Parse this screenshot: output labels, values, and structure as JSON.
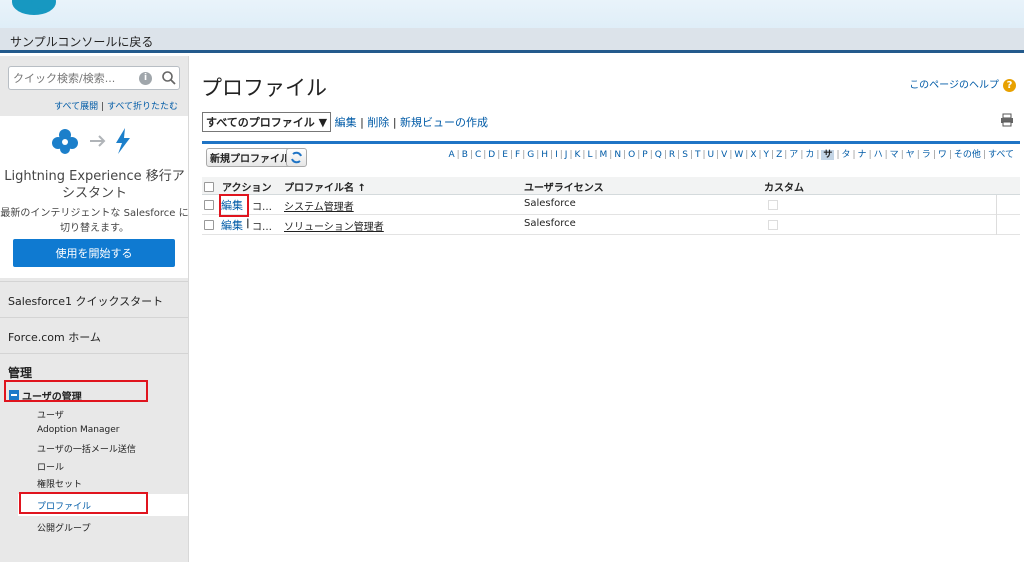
{
  "header": {
    "back_label": "サンプルコンソールに戻る"
  },
  "sidebar": {
    "search_placeholder": "クイック検索/検索...",
    "expand_all": "すべて展開",
    "collapse_all": "すべて折りたたむ",
    "expand_sep": "|",
    "lex": {
      "title": "Lightning Experience 移行アシスタント",
      "description": "最新のインテリジェントな Salesforce に切り替えます。",
      "button": "使用を開始する"
    },
    "sections": [
      {
        "label": "Salesforce1 クイックスタート"
      },
      {
        "label": "Force.com ホーム"
      }
    ],
    "admin_title": "管理",
    "user_mgmt": {
      "label": "ユーザの管理",
      "items": [
        "ユーザ",
        "Adoption Manager",
        "ユーザの一括メール送信",
        "ロール",
        "権限セット",
        "プロファイル",
        "公開グループ"
      ]
    }
  },
  "main": {
    "title": "プロファイル",
    "help_link": "このページのヘルプ",
    "view_select": "すべてのプロファイル ▼",
    "view_links": [
      "編集",
      "削除",
      "新規ビューの作成"
    ],
    "new_button": "新規プロファイル",
    "alphabet": [
      "A",
      "B",
      "C",
      "D",
      "E",
      "F",
      "G",
      "H",
      "I",
      "J",
      "K",
      "L",
      "M",
      "N",
      "O",
      "P",
      "Q",
      "R",
      "S",
      "T",
      "U",
      "V",
      "W",
      "X",
      "Y",
      "Z",
      "ア",
      "カ",
      "サ",
      "タ",
      "ナ",
      "ハ",
      "マ",
      "ヤ",
      "ラ",
      "ワ",
      "その他",
      "すべて"
    ],
    "alphabet_selected": "サ",
    "columns": {
      "action": "アクション",
      "name": "プロファイル名 ↑",
      "license": "ユーザライセンス",
      "custom": "カスタム"
    },
    "rows": [
      {
        "edit": "編集",
        "copy": "コ…",
        "name": "システム管理者",
        "license": "Salesforce"
      },
      {
        "edit": "編集",
        "copy": "コ…",
        "name": "ソリューション管理者",
        "license": "Salesforce"
      }
    ],
    "action_sep": "|"
  },
  "colors": {
    "accent": "#1f74c5",
    "highlight": "#e0141e",
    "link": "#015ba7"
  }
}
